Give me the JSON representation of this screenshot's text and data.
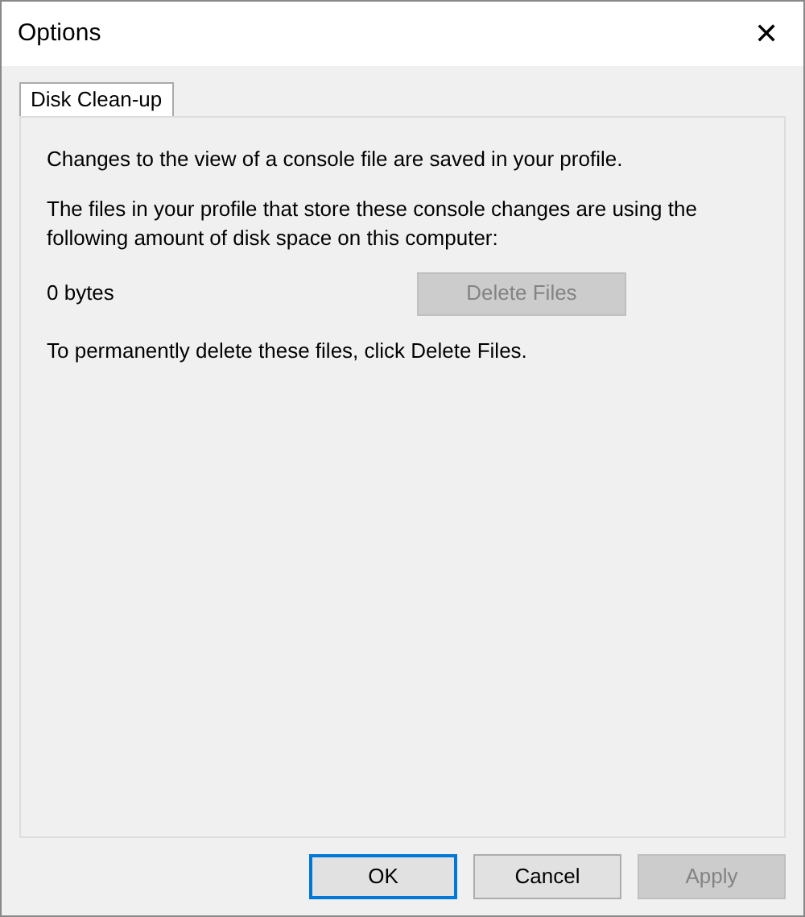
{
  "window": {
    "title": "Options",
    "close": "✕"
  },
  "tabs": [
    {
      "label": "Disk Clean-up",
      "selected": true
    }
  ],
  "panel": {
    "intro": "Changes to the view of a console file are saved in your profile.",
    "usage_text": "The files in your profile that store these console changes are using the following amount of disk space on this computer:",
    "size": "0 bytes",
    "delete_button": {
      "label": "Delete Files",
      "disabled": true
    },
    "hint": "To permanently delete these files, click Delete Files."
  },
  "buttons": [
    {
      "label": "OK",
      "default": true,
      "disabled": false
    },
    {
      "label": "Cancel",
      "default": false,
      "disabled": false
    },
    {
      "label": "Apply",
      "default": false,
      "disabled": true
    }
  ]
}
